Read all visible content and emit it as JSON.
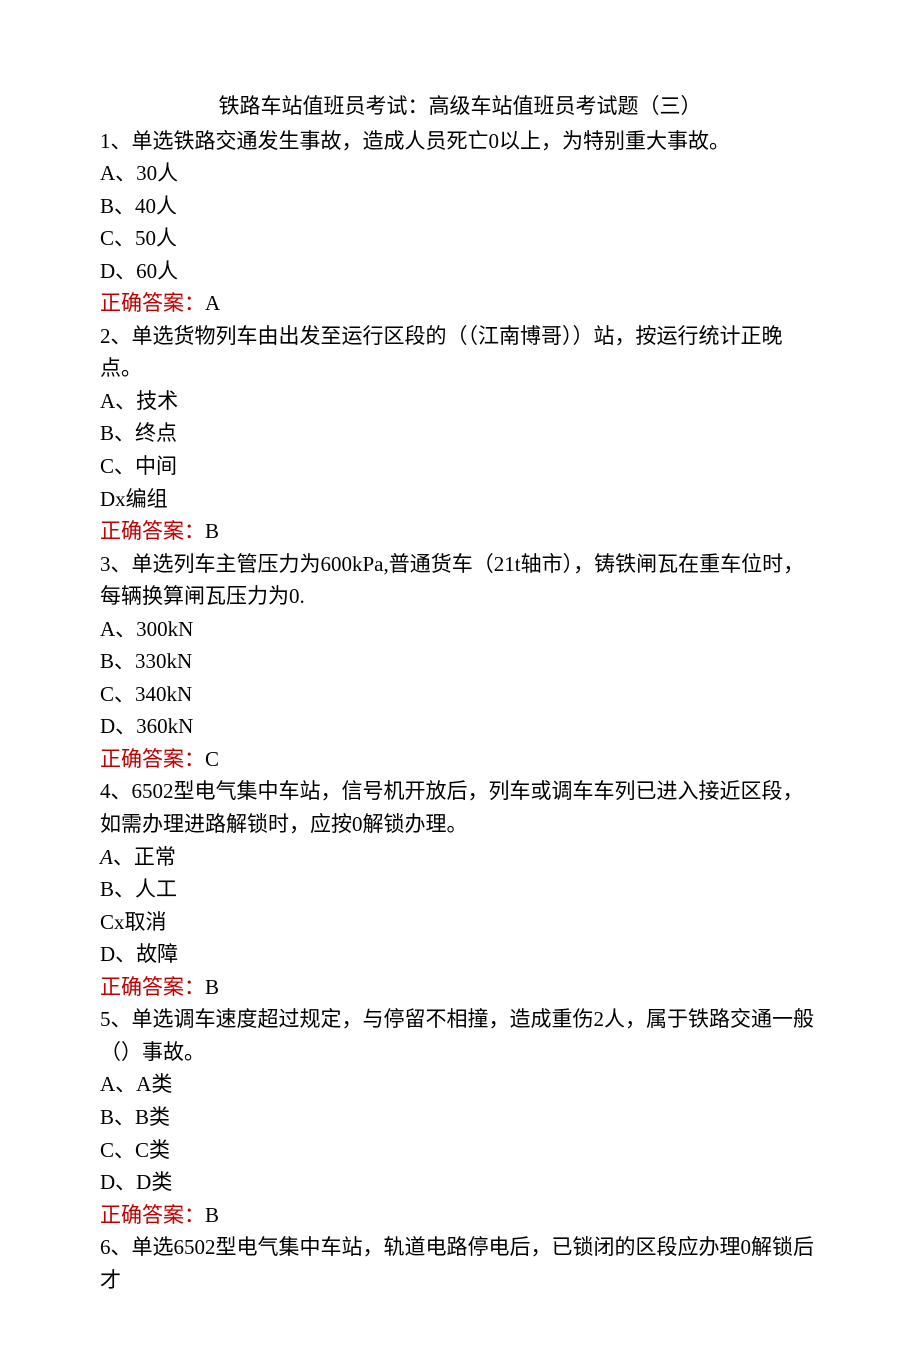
{
  "title": "铁路车站值班员考试：高级车站值班员考试题（三）",
  "questions": [
    {
      "text": "1、单选铁路交通发生事故，造成人员死亡0以上，为特别重大事故。",
      "options": [
        "A、30人",
        "B、40人",
        "C、50人",
        "D、60人"
      ],
      "answer_label": "正确答案：",
      "answer_value": "A"
    },
    {
      "text": "2、单选货物列车由出发至运行区段的（（江南博哥））站，按运行统计正晚点。",
      "options": [
        "A、技术",
        "B、终点",
        "C、中间",
        "Dx编组"
      ],
      "answer_label": "正确答案：",
      "answer_value": "B"
    },
    {
      "text": "3、单选列车主管压力为600kPa,普通货车（21t轴市），铸铁闸瓦在重车位时，每辆换算闸瓦压力为0.",
      "options": [
        "A、300kN",
        "B、330kN",
        "C、340kN",
        "D、360kN"
      ],
      "answer_label": "正确答案：",
      "answer_value": "C"
    },
    {
      "text": "4、6502型电气集中车站，信号机开放后，列车或调车车列已进入接近区段，如需办理进路解锁时，应按0解锁办理。",
      "options_special": [
        {
          "prefix_italic": "A",
          "rest": "、正常"
        },
        {
          "text": "B、人工"
        },
        {
          "text": "Cx取消"
        },
        {
          "text": "D、故障"
        }
      ],
      "answer_label": "正确答案：",
      "answer_value": "B"
    },
    {
      "text": "5、单选调车速度超过规定，与停留不相撞，造成重伤2人，属于铁路交通一般（）事故。",
      "options": [
        "A、A类",
        "B、B类",
        "C、C类",
        "D、D类"
      ],
      "answer_label": "正确答案：",
      "answer_value": "B"
    },
    {
      "text": "6、单选6502型电气集中车站，轨道电路停电后，已锁闭的区段应办理0解锁后才"
    }
  ]
}
